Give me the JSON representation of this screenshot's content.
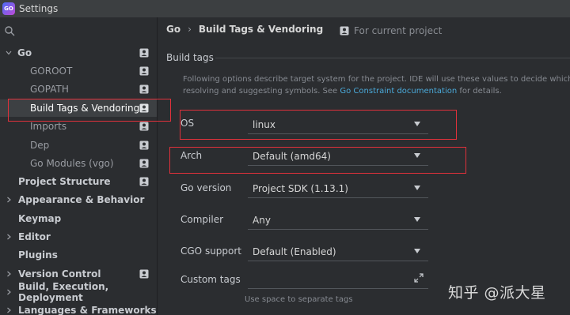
{
  "window": {
    "title": "Settings",
    "app_icon_text": "GO"
  },
  "sidebar": {
    "search_placeholder": "",
    "items": [
      {
        "label": "Go"
      },
      {
        "label": "GOROOT"
      },
      {
        "label": "GOPATH"
      },
      {
        "label": "Build Tags & Vendoring"
      },
      {
        "label": "Imports"
      },
      {
        "label": "Dep"
      },
      {
        "label": "Go Modules (vgo)"
      },
      {
        "label": "Project Structure"
      },
      {
        "label": "Appearance & Behavior"
      },
      {
        "label": "Keymap"
      },
      {
        "label": "Editor"
      },
      {
        "label": "Plugins"
      },
      {
        "label": "Version Control"
      },
      {
        "label": "Build, Execution, Deployment"
      },
      {
        "label": "Languages & Frameworks"
      }
    ]
  },
  "breadcrumb": {
    "parent": "Go",
    "separator": "›",
    "current": "Build Tags & Vendoring"
  },
  "scope_label": "For current project",
  "section": {
    "title": "Build tags",
    "description_line1": "Following options describe target system for the project. IDE will use these values to decide which files sho",
    "description_line2_prefix": "resolving and suggesting symbols. See ",
    "description_link": "Go Constraint documentation",
    "description_line2_suffix": " for details."
  },
  "fields": {
    "os": {
      "label": "OS",
      "value": "linux"
    },
    "arch": {
      "label": "Arch",
      "value": "Default (amd64)"
    },
    "go_version": {
      "label": "Go version",
      "value": "Project SDK (1.13.1)"
    },
    "compiler": {
      "label": "Compiler",
      "value": "Any"
    },
    "cgo": {
      "label": "CGO support",
      "value": "Default (Enabled)"
    },
    "custom_tags": {
      "label": "Custom tags",
      "value": "",
      "hint": "Use space to separate tags"
    }
  },
  "watermark": "知乎 @派大星",
  "colors": {
    "highlight": "#e0313b",
    "link": "#4aa9d9",
    "selected_bg": "#3d4043"
  }
}
